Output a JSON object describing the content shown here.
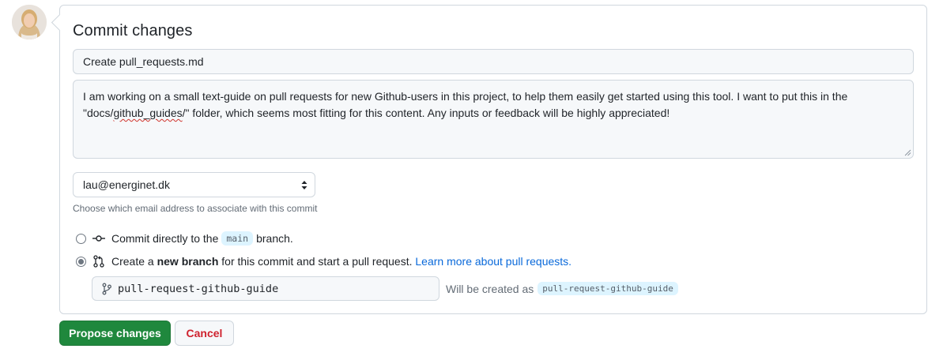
{
  "avatar": {
    "icon": "user-avatar"
  },
  "commit": {
    "heading": "Commit changes",
    "summary_value": "Create pull_requests.md",
    "description_line1": "I am working on a small text-guide on pull requests for new Github-users in this project, to help them easily get started using this tool. I want to put this in the",
    "description_line2_pre": "\"docs/",
    "description_line2_misspelled": "github_guides",
    "description_line2_post": "/\" folder, which seems most fitting for this content. Any inputs or feedback will be highly appreciated!",
    "email_selected": "lau@energinet.dk",
    "email_hint": "Choose which email address to associate with this commit",
    "option_direct": {
      "pre": "Commit directly to the",
      "branch": "main",
      "post": "branch.",
      "checked": false
    },
    "option_new_branch": {
      "pre": "Create a",
      "bold": "new branch",
      "post": "for this commit and start a pull request.",
      "link": "Learn more about pull requests.",
      "checked": true
    },
    "branch_name": "pull-request-github-guide",
    "will_be_created_label": "Will be created as",
    "will_be_created_branch": "pull-request-github-guide"
  },
  "buttons": {
    "propose": "Propose changes",
    "cancel": "Cancel"
  },
  "colors": {
    "primary_button": "#1f883d",
    "cancel_text": "#cf222e",
    "link": "#0969da",
    "branch_pill_bg": "#ddf4ff"
  }
}
